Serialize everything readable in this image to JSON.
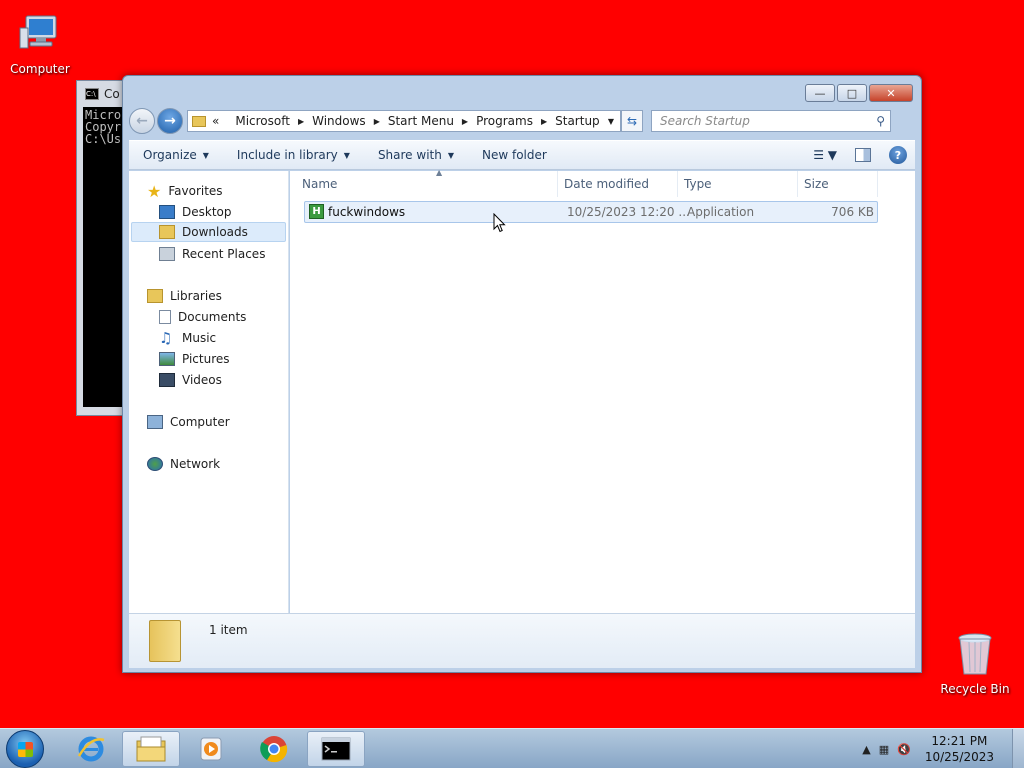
{
  "desktop": {
    "background": "#ff0000",
    "icons": [
      {
        "label": "Computer",
        "icon": "computer-icon"
      },
      {
        "label": "Recycle Bin",
        "icon": "recycle-bin-icon"
      }
    ]
  },
  "console": {
    "title": "Co",
    "lines": [
      "Micro",
      "Copyr",
      "",
      "C:\\Us"
    ]
  },
  "explorer": {
    "window_controls": {
      "minimize": "—",
      "maximize": "□",
      "close": "✕"
    },
    "breadcrumb": {
      "overflow": "«",
      "items": [
        "Microsoft",
        "Windows",
        "Start Menu",
        "Programs",
        "Startup"
      ]
    },
    "search_placeholder": "Search Startup",
    "toolbar": {
      "organize": "Organize",
      "include_in_library": "Include in library",
      "share_with": "Share with",
      "new_folder": "New folder"
    },
    "nav_pane": {
      "favorites": {
        "label": "Favorites",
        "items": [
          "Desktop",
          "Downloads",
          "Recent Places"
        ]
      },
      "libraries": {
        "label": "Libraries",
        "items": [
          "Documents",
          "Music",
          "Pictures",
          "Videos"
        ]
      },
      "computer": "Computer",
      "network": "Network",
      "selected": "Downloads"
    },
    "columns": {
      "name": "Name",
      "date_modified": "Date modified",
      "type": "Type",
      "size": "Size"
    },
    "files": [
      {
        "name": "fuckwindows",
        "date_modified": "10/25/2023 12:20 ...",
        "type": "Application",
        "size": "706 KB"
      }
    ],
    "details": {
      "count": "1 item"
    }
  },
  "taskbar": {
    "start": "start-button",
    "pinned": [
      "internet-explorer-icon",
      "windows-explorer-icon",
      "media-player-icon",
      "chrome-icon",
      "command-prompt-icon"
    ],
    "clock": {
      "time": "12:21 PM",
      "date": "10/25/2023"
    }
  }
}
